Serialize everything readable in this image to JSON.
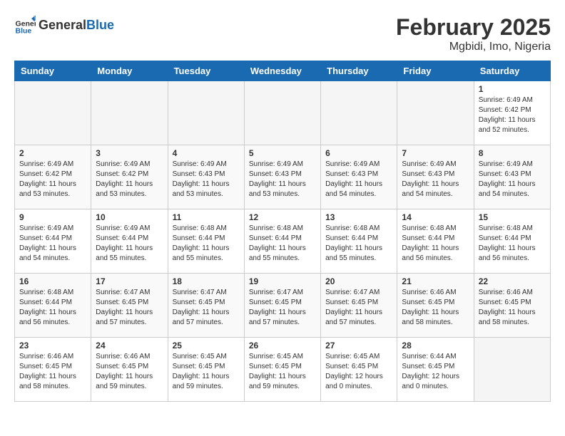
{
  "header": {
    "logo": {
      "general": "General",
      "blue": "Blue"
    },
    "title": "February 2025",
    "location": "Mgbidi, Imo, Nigeria"
  },
  "calendar": {
    "weekdays": [
      "Sunday",
      "Monday",
      "Tuesday",
      "Wednesday",
      "Thursday",
      "Friday",
      "Saturday"
    ],
    "weeks": [
      [
        {
          "day": "",
          "info": ""
        },
        {
          "day": "",
          "info": ""
        },
        {
          "day": "",
          "info": ""
        },
        {
          "day": "",
          "info": ""
        },
        {
          "day": "",
          "info": ""
        },
        {
          "day": "",
          "info": ""
        },
        {
          "day": "1",
          "info": "Sunrise: 6:49 AM\nSunset: 6:42 PM\nDaylight: 11 hours and 52 minutes."
        }
      ],
      [
        {
          "day": "2",
          "info": "Sunrise: 6:49 AM\nSunset: 6:42 PM\nDaylight: 11 hours and 53 minutes."
        },
        {
          "day": "3",
          "info": "Sunrise: 6:49 AM\nSunset: 6:42 PM\nDaylight: 11 hours and 53 minutes."
        },
        {
          "day": "4",
          "info": "Sunrise: 6:49 AM\nSunset: 6:43 PM\nDaylight: 11 hours and 53 minutes."
        },
        {
          "day": "5",
          "info": "Sunrise: 6:49 AM\nSunset: 6:43 PM\nDaylight: 11 hours and 53 minutes."
        },
        {
          "day": "6",
          "info": "Sunrise: 6:49 AM\nSunset: 6:43 PM\nDaylight: 11 hours and 54 minutes."
        },
        {
          "day": "7",
          "info": "Sunrise: 6:49 AM\nSunset: 6:43 PM\nDaylight: 11 hours and 54 minutes."
        },
        {
          "day": "8",
          "info": "Sunrise: 6:49 AM\nSunset: 6:43 PM\nDaylight: 11 hours and 54 minutes."
        }
      ],
      [
        {
          "day": "9",
          "info": "Sunrise: 6:49 AM\nSunset: 6:44 PM\nDaylight: 11 hours and 54 minutes."
        },
        {
          "day": "10",
          "info": "Sunrise: 6:49 AM\nSunset: 6:44 PM\nDaylight: 11 hours and 55 minutes."
        },
        {
          "day": "11",
          "info": "Sunrise: 6:48 AM\nSunset: 6:44 PM\nDaylight: 11 hours and 55 minutes."
        },
        {
          "day": "12",
          "info": "Sunrise: 6:48 AM\nSunset: 6:44 PM\nDaylight: 11 hours and 55 minutes."
        },
        {
          "day": "13",
          "info": "Sunrise: 6:48 AM\nSunset: 6:44 PM\nDaylight: 11 hours and 55 minutes."
        },
        {
          "day": "14",
          "info": "Sunrise: 6:48 AM\nSunset: 6:44 PM\nDaylight: 11 hours and 56 minutes."
        },
        {
          "day": "15",
          "info": "Sunrise: 6:48 AM\nSunset: 6:44 PM\nDaylight: 11 hours and 56 minutes."
        }
      ],
      [
        {
          "day": "16",
          "info": "Sunrise: 6:48 AM\nSunset: 6:44 PM\nDaylight: 11 hours and 56 minutes."
        },
        {
          "day": "17",
          "info": "Sunrise: 6:47 AM\nSunset: 6:45 PM\nDaylight: 11 hours and 57 minutes."
        },
        {
          "day": "18",
          "info": "Sunrise: 6:47 AM\nSunset: 6:45 PM\nDaylight: 11 hours and 57 minutes."
        },
        {
          "day": "19",
          "info": "Sunrise: 6:47 AM\nSunset: 6:45 PM\nDaylight: 11 hours and 57 minutes."
        },
        {
          "day": "20",
          "info": "Sunrise: 6:47 AM\nSunset: 6:45 PM\nDaylight: 11 hours and 57 minutes."
        },
        {
          "day": "21",
          "info": "Sunrise: 6:46 AM\nSunset: 6:45 PM\nDaylight: 11 hours and 58 minutes."
        },
        {
          "day": "22",
          "info": "Sunrise: 6:46 AM\nSunset: 6:45 PM\nDaylight: 11 hours and 58 minutes."
        }
      ],
      [
        {
          "day": "23",
          "info": "Sunrise: 6:46 AM\nSunset: 6:45 PM\nDaylight: 11 hours and 58 minutes."
        },
        {
          "day": "24",
          "info": "Sunrise: 6:46 AM\nSunset: 6:45 PM\nDaylight: 11 hours and 59 minutes."
        },
        {
          "day": "25",
          "info": "Sunrise: 6:45 AM\nSunset: 6:45 PM\nDaylight: 11 hours and 59 minutes."
        },
        {
          "day": "26",
          "info": "Sunrise: 6:45 AM\nSunset: 6:45 PM\nDaylight: 11 hours and 59 minutes."
        },
        {
          "day": "27",
          "info": "Sunrise: 6:45 AM\nSunset: 6:45 PM\nDaylight: 12 hours and 0 minutes."
        },
        {
          "day": "28",
          "info": "Sunrise: 6:44 AM\nSunset: 6:45 PM\nDaylight: 12 hours and 0 minutes."
        },
        {
          "day": "",
          "info": ""
        }
      ]
    ]
  }
}
